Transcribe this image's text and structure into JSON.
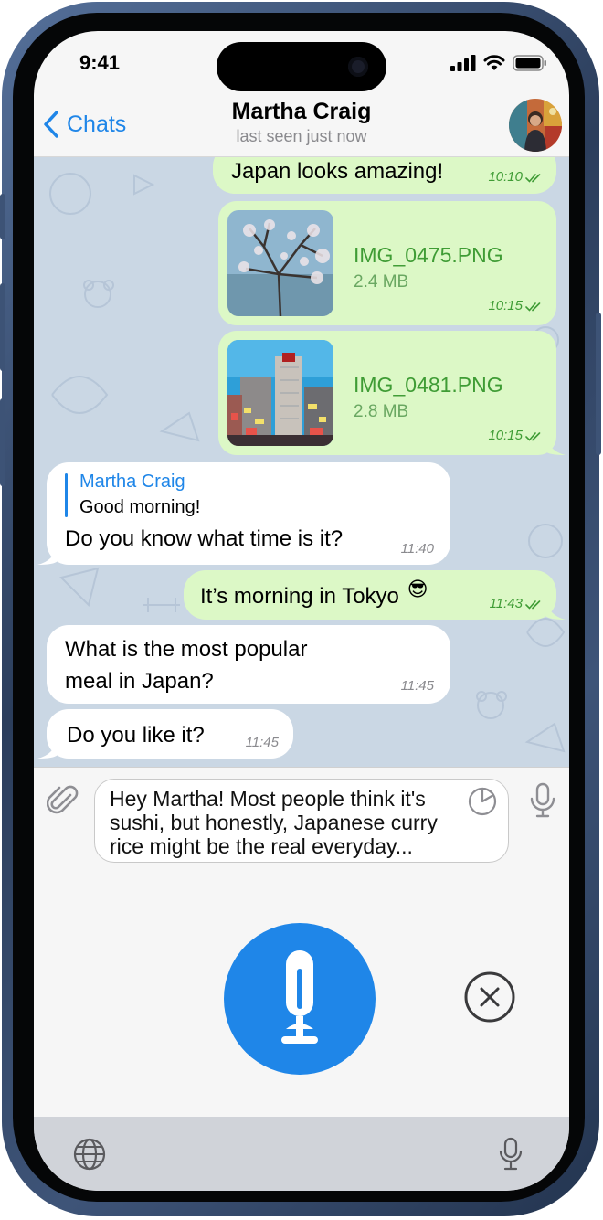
{
  "status_bar": {
    "time": "9:41"
  },
  "header": {
    "back_label": "Chats",
    "contact_name": "Martha Craig",
    "contact_status": "last seen just now"
  },
  "messages": [
    {
      "direction": "outgoing",
      "text": "Japan looks amazing!",
      "time": "10:10",
      "read": true
    },
    {
      "direction": "outgoing",
      "type": "file",
      "file_name": "IMG_0475.PNG",
      "file_size": "2.4 MB",
      "time": "10:15",
      "read": true
    },
    {
      "direction": "outgoing",
      "type": "file",
      "file_name": "IMG_0481.PNG",
      "file_size": "2.8 MB",
      "time": "10:15",
      "read": true
    },
    {
      "direction": "incoming",
      "reply_to_name": "Martha Craig",
      "reply_to_text": "Good morning!",
      "text": "Do you know what time is it?",
      "time": "11:40"
    },
    {
      "direction": "outgoing",
      "text": "It’s morning in Tokyo",
      "emoji": "😎",
      "time": "11:43",
      "read": true
    },
    {
      "direction": "incoming",
      "text_line1": "What is the most popular",
      "text_line2": "meal in Japan?",
      "time": "11:45"
    },
    {
      "direction": "incoming",
      "text": "Do you like it?",
      "time": "11:45"
    }
  ],
  "composer": {
    "text_line1": "Hey Martha! Most people think it's",
    "text_line2": "sushi, but honestly, Japanese curry",
    "text_line3": "rice might be the real everyday..."
  },
  "colors": {
    "accent": "#1f86e8",
    "outgoing_bubble": "#dcf8c6",
    "incoming_bubble": "#ffffff",
    "chat_background": "#cad7e4",
    "outgoing_meta": "#3f9c35"
  },
  "icons": [
    "chevron-left-icon",
    "paperclip-icon",
    "pie-timer-icon",
    "microphone-icon",
    "close-circle-icon",
    "globe-icon",
    "double-check-icon",
    "signal-icon",
    "wifi-icon",
    "battery-icon"
  ]
}
